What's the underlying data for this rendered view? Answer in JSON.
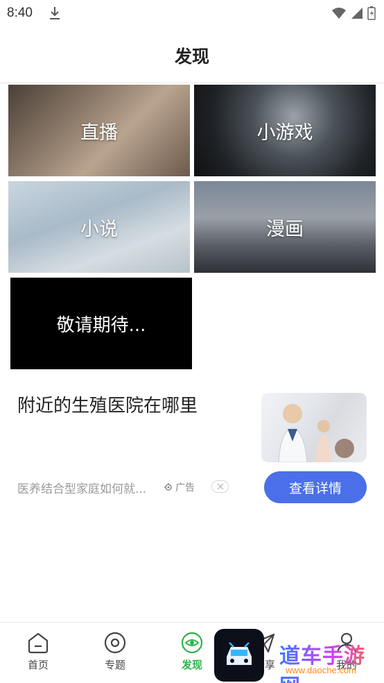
{
  "status_bar": {
    "time": "8:40"
  },
  "header": {
    "title": "发现"
  },
  "tiles": [
    {
      "label": "直播"
    },
    {
      "label": "小游戏"
    },
    {
      "label": "小说"
    },
    {
      "label": "漫画"
    },
    {
      "label": "敬请期待..."
    }
  ],
  "ad": {
    "title": "附近的生殖医院在哪里",
    "description": "医养结合型家庭如何就...",
    "tag": "广告",
    "cta": "查看详情"
  },
  "bottom_nav": {
    "items": [
      {
        "label": "首页",
        "icon": "home-icon"
      },
      {
        "label": "专题",
        "icon": "topic-icon"
      },
      {
        "label": "发现",
        "icon": "discover-eye-icon"
      },
      {
        "label": "分享",
        "icon": "share-icon"
      },
      {
        "label": "我的",
        "icon": "profile-icon"
      }
    ],
    "active_color": "#2db34a"
  },
  "watermark": {
    "text": "道车手游网",
    "sub": "www.daoche.com"
  },
  "colors": {
    "accent": "#4a6fe8",
    "active_nav": "#2db34a"
  }
}
